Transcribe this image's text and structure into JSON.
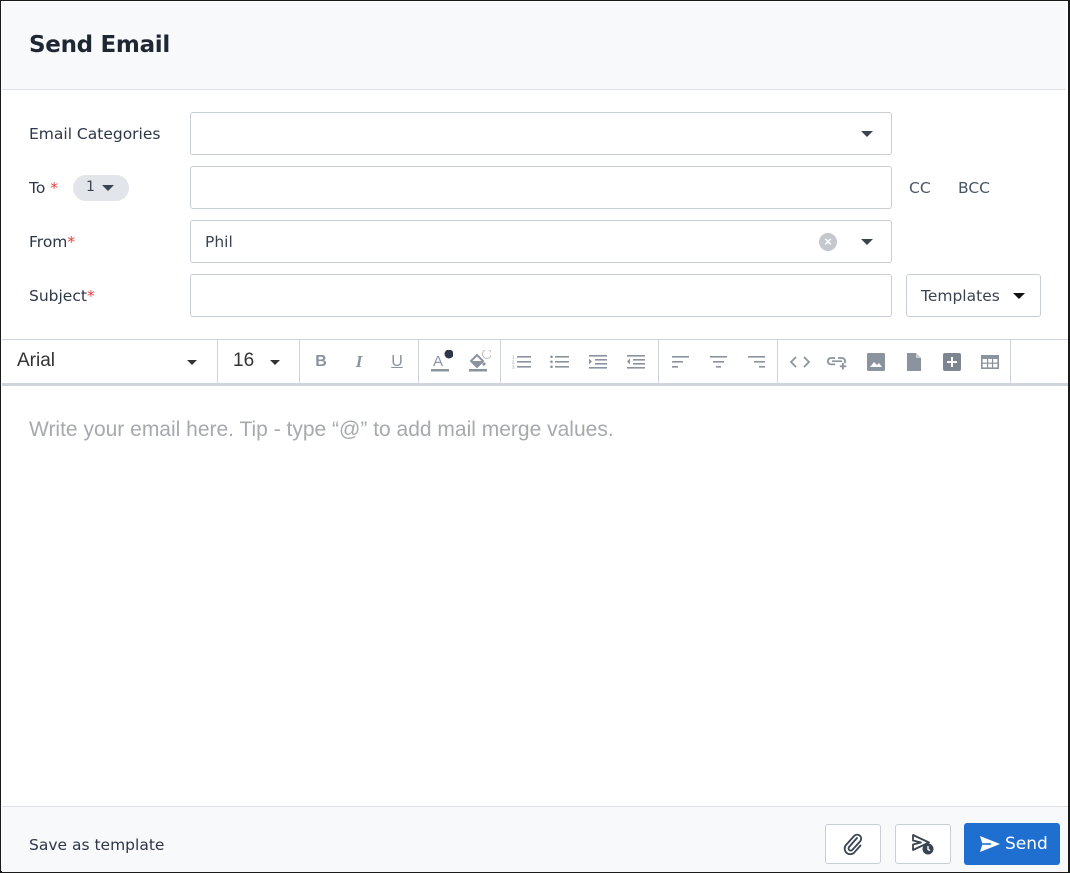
{
  "dialog": {
    "title": "Send Email"
  },
  "form": {
    "categories": {
      "label": "Email Categories",
      "value": ""
    },
    "to": {
      "label": "To",
      "required_mark": "*",
      "recipient_count": "1",
      "value": ""
    },
    "from": {
      "label": "From",
      "required_mark": "*",
      "value": "Phil"
    },
    "subject": {
      "label": "Subject",
      "required_mark": "*",
      "value": ""
    },
    "cc_label": "CC",
    "bcc_label": "BCC",
    "templates_label": "Templates"
  },
  "toolbar": {
    "font_family": "Arial",
    "font_size": "16",
    "buttons": [
      {
        "name": "bold-icon"
      },
      {
        "name": "italic-icon"
      },
      {
        "name": "underline-icon"
      },
      {
        "name": "text-color-icon"
      },
      {
        "name": "highlight-color-icon"
      },
      {
        "name": "ordered-list-icon"
      },
      {
        "name": "unordered-list-icon"
      },
      {
        "name": "indent-icon"
      },
      {
        "name": "outdent-icon"
      },
      {
        "name": "align-left-icon"
      },
      {
        "name": "align-center-icon"
      },
      {
        "name": "align-right-icon"
      },
      {
        "name": "code-view-icon"
      },
      {
        "name": "insert-link-icon"
      },
      {
        "name": "insert-image-icon"
      },
      {
        "name": "insert-file-icon"
      },
      {
        "name": "insert-plus-icon"
      },
      {
        "name": "insert-table-icon"
      }
    ],
    "bold_glyph": "B",
    "italic_glyph": "I",
    "underline_glyph": "U",
    "text_color_glyph": "A"
  },
  "editor": {
    "placeholder": "Write your email here. Tip - type “@” to add mail merge values."
  },
  "footer": {
    "save_template_label": "Save as template",
    "send_label": "Send"
  },
  "colors": {
    "accent": "#1f6fd1",
    "required": "#e53e3e"
  }
}
